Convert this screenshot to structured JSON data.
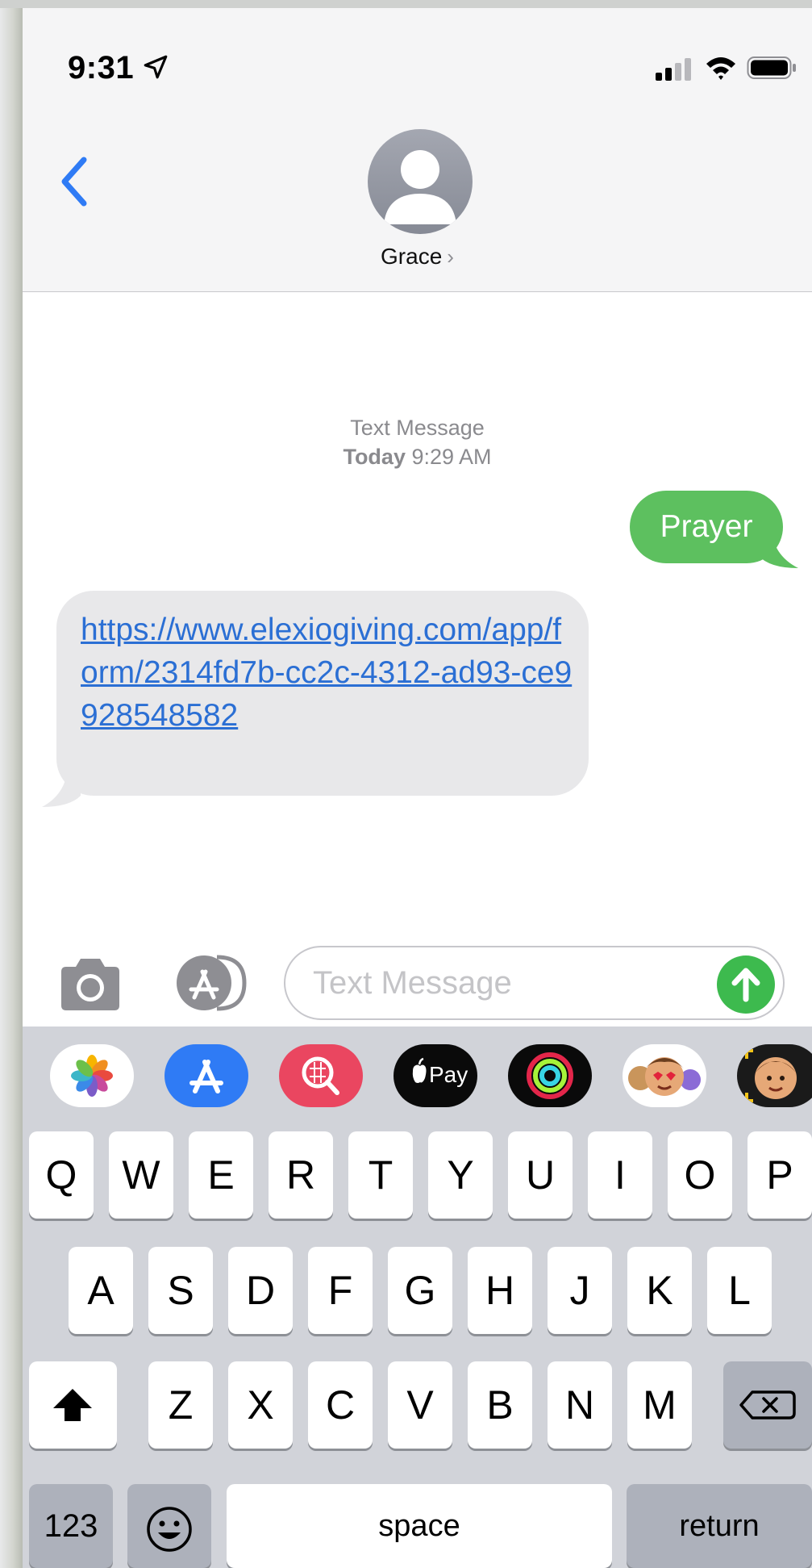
{
  "status_bar": {
    "time": "9:31"
  },
  "header": {
    "contact_name": "Grace",
    "chevron": "›"
  },
  "conversation": {
    "timestamp_label": "Text Message",
    "timestamp_day": "Today",
    "timestamp_time": "9:29 AM",
    "messages": [
      {
        "direction": "outgoing",
        "text": "Prayer"
      },
      {
        "direction": "incoming",
        "text": "https://www.elexiogiving.com/app/form/2314fd7b-cc2c-4312-ad93-ce9928548582"
      }
    ]
  },
  "input": {
    "placeholder": "Text Message",
    "value": ""
  },
  "app_strip": [
    "photos-app-icon",
    "app-store-icon",
    "images-search-icon",
    "apple-pay-icon",
    "activity-icon",
    "memoji-stickers-icon",
    "animoji-icon"
  ],
  "apple_pay_label": "Pay",
  "keyboard": {
    "row1": [
      "Q",
      "W",
      "E",
      "R",
      "T",
      "Y",
      "U",
      "I",
      "O",
      "P"
    ],
    "row2": [
      "A",
      "S",
      "D",
      "F",
      "G",
      "H",
      "J",
      "K",
      "L"
    ],
    "row3": [
      "Z",
      "X",
      "C",
      "V",
      "B",
      "N",
      "M"
    ],
    "numbers_label": "123",
    "space_label": "space",
    "return_label": "return"
  },
  "colors": {
    "outgoing_bubble": "#5dc05f",
    "incoming_bubble": "#e8e8ea",
    "link": "#2b6fd4",
    "accent": "#2f7bf5",
    "send": "#3dba4e"
  }
}
